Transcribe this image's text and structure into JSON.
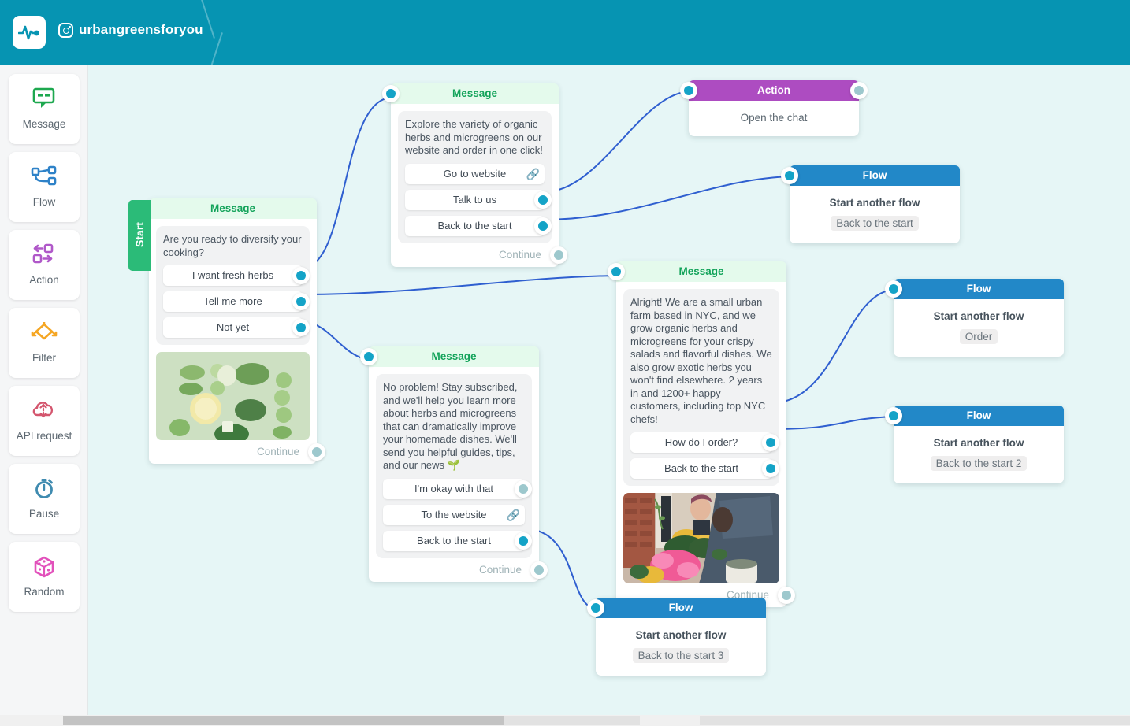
{
  "header": {
    "account_name": "urbangreensforyou",
    "logo_icon": "pulse-logo-icon",
    "social_icon": "instagram-icon",
    "background_color": "#0694b2"
  },
  "sidebar": {
    "items": [
      {
        "label": "Message",
        "icon": "message-icon",
        "color": "#1da84f"
      },
      {
        "label": "Flow",
        "icon": "flow-icon",
        "color": "#2e82c8"
      },
      {
        "label": "Action",
        "icon": "action-icon",
        "color": "#b058c9"
      },
      {
        "label": "Filter",
        "icon": "filter-icon",
        "color": "#f5a623"
      },
      {
        "label": "API request",
        "icon": "api-request-icon",
        "color": "#d4566e"
      },
      {
        "label": "Pause",
        "icon": "pause-timer-icon",
        "color": "#3f8bb0"
      },
      {
        "label": "Random",
        "icon": "random-dice-icon",
        "color": "#e251bb"
      }
    ]
  },
  "canvas": {
    "background_color": "#e6f6f6",
    "wire_color": "#2f5fd0",
    "start_label": "Start",
    "continue_label": "Continue",
    "nodes": [
      {
        "id": "msg-start",
        "type": "Message",
        "header": "Message",
        "text": "Are you ready to diversify your cooking?",
        "buttons": [
          {
            "label": "I want fresh herbs",
            "port": "active"
          },
          {
            "label": "Tell me more",
            "port": "active"
          },
          {
            "label": "Not yet",
            "port": "active"
          }
        ],
        "image": "green-vegetables-flatlay",
        "continue": "Continue"
      },
      {
        "id": "msg-explore",
        "type": "Message",
        "header": "Message",
        "text": "Explore the variety of organic herbs and microgreens on our website and order in one click!",
        "buttons": [
          {
            "label": "Go to website",
            "port": "link"
          },
          {
            "label": "Talk to us",
            "port": "active"
          },
          {
            "label": "Back to the start",
            "port": "active"
          }
        ],
        "continue": "Continue"
      },
      {
        "id": "action-open-chat",
        "type": "Action",
        "header": "Action",
        "title": "Open the chat"
      },
      {
        "id": "flow-back-to-start",
        "type": "Flow",
        "header": "Flow",
        "title": "Start another flow",
        "chip": "Back to the start"
      },
      {
        "id": "msg-about",
        "type": "Message",
        "header": "Message",
        "text": "Alright! We are a small urban farm based in NYC, and we grow organic herbs and microgreens for your crispy salads and flavorful dishes. We also grow exotic herbs you won't find elsewhere. 2 years in and 1200+ happy customers, including top NYC chefs!",
        "buttons": [
          {
            "label": "How do I order?",
            "port": "active"
          },
          {
            "label": "Back to the start",
            "port": "active"
          }
        ],
        "image": "gardening-flowers-photo",
        "continue": "Continue"
      },
      {
        "id": "msg-no-problem",
        "type": "Message",
        "header": "Message",
        "text": "No problem! Stay subscribed, and we'll help you learn more about herbs and microgreens that can dramatically improve your homemade dishes. We'll send you helpful guides, tips, and our news 🌱",
        "buttons": [
          {
            "label": "I'm okay with that",
            "port": "muted"
          },
          {
            "label": "To the website",
            "port": "link"
          },
          {
            "label": "Back to the start",
            "port": "active"
          }
        ],
        "continue": "Continue"
      },
      {
        "id": "flow-order",
        "type": "Flow",
        "header": "Flow",
        "title": "Start another flow",
        "chip": "Order"
      },
      {
        "id": "flow-back-to-start-2",
        "type": "Flow",
        "header": "Flow",
        "title": "Start another flow",
        "chip": "Back to the start 2"
      },
      {
        "id": "flow-back-to-start-3",
        "type": "Flow",
        "header": "Flow",
        "title": "Start another flow",
        "chip": "Back to the start 3"
      }
    ]
  }
}
